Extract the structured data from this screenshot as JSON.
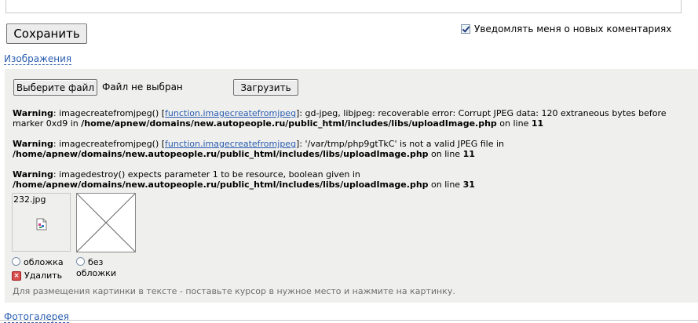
{
  "form": {
    "save_label": "Сохранить",
    "notify_label": "Уведомлять меня о новых коментариях",
    "notify_checked": true
  },
  "images": {
    "section_title": "Изображения",
    "choose_file_label": "Выберите файл",
    "no_file_text": "Файл не выбран",
    "upload_label": "Загрузить",
    "warnings": [
      {
        "label": "Warning",
        "pre": ": imagecreatefromjpeg() [",
        "link": "function.imagecreatefromjpeg",
        "post": "]: gd-jpeg, libjpeg: recoverable error: Corrupt JPEG data: 120 extraneous bytes before",
        "line2_pre": "marker 0xd9 in ",
        "path": "/home/apnew/domains/new.autopeople.ru/public_html/includes/libs/uploadImage.php",
        "on_line": " on line ",
        "line_no": "11"
      },
      {
        "label": "Warning",
        "pre": ": imagecreatefromjpeg() [",
        "link": "function.imagecreatefromjpeg",
        "post": "]: '/var/tmp/php9gtTkC' is not a valid JPEG file in",
        "path": "/home/apnew/domains/new.autopeople.ru/public_html/includes/libs/uploadImage.php",
        "on_line": " on line ",
        "line_no": "11"
      },
      {
        "label": "Warning",
        "pre": ": imagedestroy() expects parameter 1 to be resource, boolean given in",
        "path": "/home/apnew/domains/new.autopeople.ru/public_html/includes/libs/uploadImage.php",
        "on_line": " on line ",
        "line_no": "31"
      }
    ],
    "thumb_filename": "232.jpg",
    "cover_label": "обложка",
    "no_cover_line1": "без",
    "no_cover_line2": "обложки",
    "delete_label": "Удалить",
    "hint": "Для размещения картинки в тексте - поставьте курсор в нужное место и нажмите на картинку."
  },
  "gallery": {
    "section_title": "Фотогалерея"
  }
}
